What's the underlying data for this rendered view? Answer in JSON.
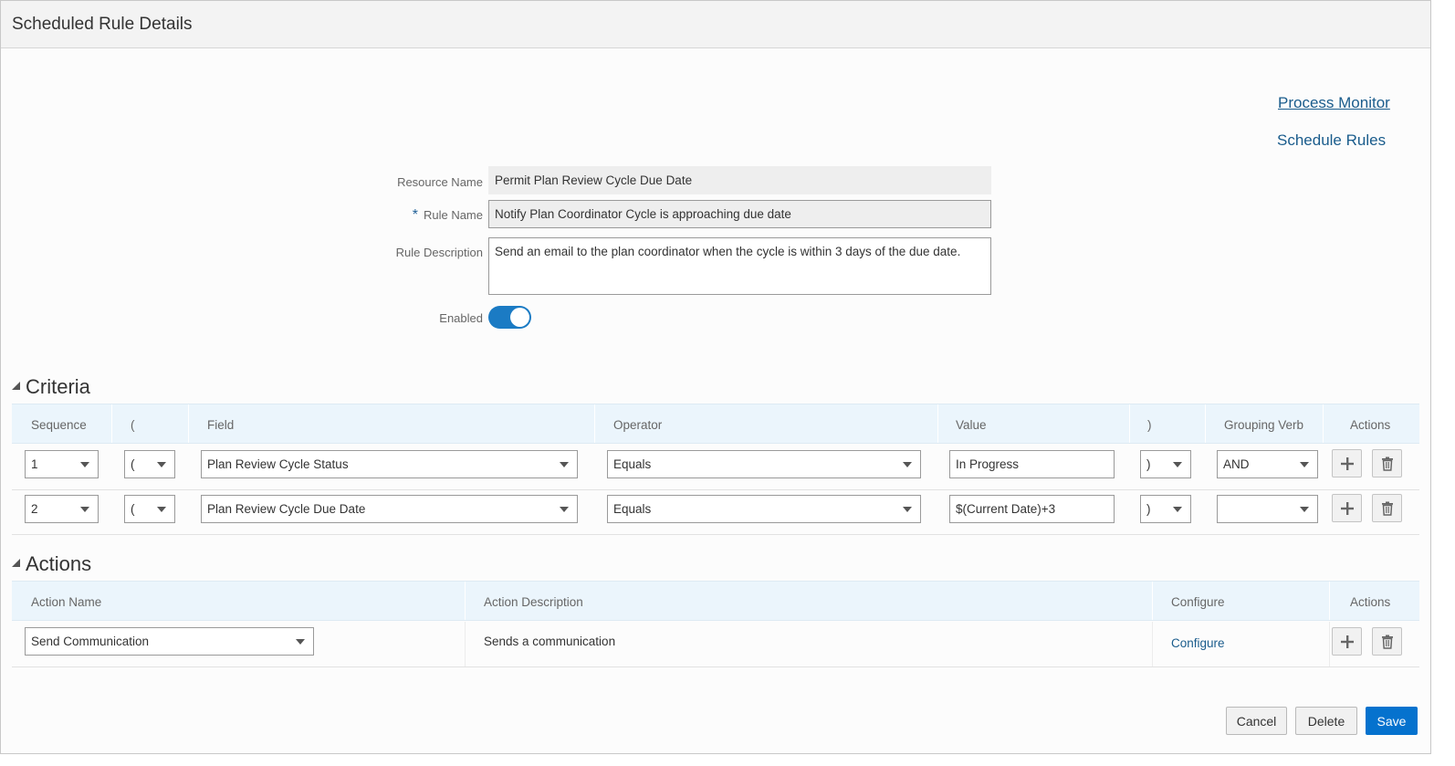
{
  "header": {
    "title": "Scheduled Rule Details"
  },
  "links": {
    "process_monitor": "Process Monitor",
    "schedule_rules": "Schedule Rules"
  },
  "form": {
    "resource_name_label": "Resource Name",
    "resource_name_value": "Permit Plan Review Cycle Due Date",
    "required_marker": "*",
    "rule_name_label": "Rule Name",
    "rule_name_value": "Notify Plan Coordinator Cycle is approaching due date",
    "rule_description_label": "Rule Description",
    "rule_description_value": "Send an email to the plan coordinator when the cycle is within 3 days of the due date.",
    "enabled_label": "Enabled",
    "enabled": true
  },
  "criteria": {
    "title": "Criteria",
    "headers": [
      "Sequence",
      "(",
      "Field",
      "Operator",
      "Value",
      ")",
      "Grouping Verb",
      "Actions"
    ],
    "rows": [
      {
        "sequence": "1",
        "open_paren": "(",
        "field": "Plan Review Cycle Status",
        "operator": "Equals",
        "value": "In Progress",
        "close_paren": ")",
        "grouping_verb": "AND"
      },
      {
        "sequence": "2",
        "open_paren": "(",
        "field": "Plan Review Cycle Due Date",
        "operator": "Equals",
        "value": "$(Current Date)+3",
        "close_paren": ")",
        "grouping_verb": ""
      }
    ]
  },
  "actions": {
    "title": "Actions",
    "headers": [
      "Action Name",
      "Action Description",
      "Configure",
      "Actions"
    ],
    "rows": [
      {
        "action_name": "Send Communication",
        "action_description": "Sends a communication",
        "configure_link": "Configure"
      }
    ]
  },
  "buttons": {
    "cancel": "Cancel",
    "delete": "Delete",
    "save": "Save"
  },
  "colors": {
    "accent": "#0572ce",
    "link": "#1a5c8c",
    "toggle_on": "#1b7bc4",
    "grid_header": "#ebf5fc"
  }
}
